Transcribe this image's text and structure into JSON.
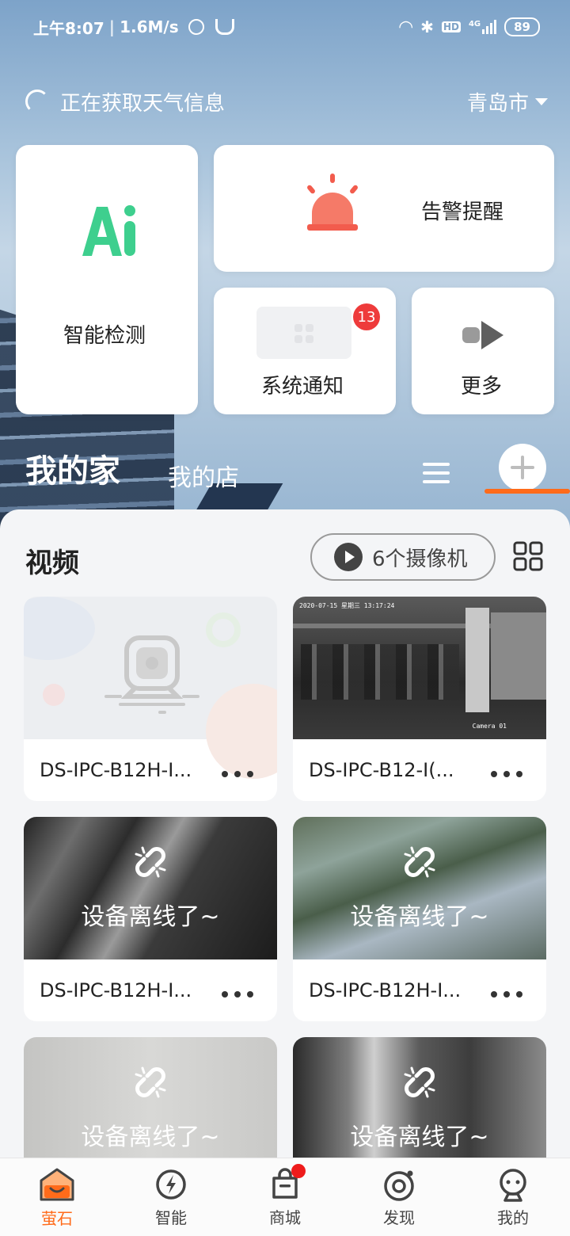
{
  "status_bar": {
    "time": "上午8:07",
    "speed": "1.6M/s",
    "signal": "4G",
    "hd": "HD",
    "battery": "89"
  },
  "weather": {
    "loading_text": "正在获取天气信息",
    "city": "青岛市"
  },
  "cards": {
    "ai": "智能检测",
    "alarm": "告警提醒",
    "notice": "系统通知",
    "notice_badge": "13",
    "more": "更多"
  },
  "tabs": {
    "home": "我的家",
    "store": "我的店"
  },
  "section": {
    "title": "视频",
    "camera_count": "6个摄像机"
  },
  "devices": [
    {
      "name": "DS-IPC-B12H-I...",
      "status": "placeholder"
    },
    {
      "name": "DS-IPC-B12-I(...",
      "status": "live",
      "overlay_top": "2020-07-15 星期三 13:17:24",
      "overlay_bottom": "Camera 01"
    },
    {
      "name": "DS-IPC-B12H-I...",
      "status": "offline",
      "status_text": "设备离线了~"
    },
    {
      "name": "DS-IPC-B12H-I...",
      "status": "offline",
      "status_text": "设备离线了~"
    },
    {
      "name": "",
      "status": "offline",
      "status_text": "设备离线了~"
    },
    {
      "name": "",
      "status": "offline",
      "status_text": "设备离线了~"
    }
  ],
  "bottom_nav": [
    {
      "label": "萤石",
      "icon": "home-icon",
      "active": true
    },
    {
      "label": "智能",
      "icon": "lightning-icon"
    },
    {
      "label": "商城",
      "icon": "shop-bag-icon"
    },
    {
      "label": "发现",
      "icon": "discover-icon"
    },
    {
      "label": "我的",
      "icon": "profile-icon"
    }
  ],
  "colors": {
    "accent": "#ff6b1a",
    "badge": "#ee3b3b",
    "ai_green": "#3ecf8e",
    "alarm_red": "#f25c4d"
  }
}
